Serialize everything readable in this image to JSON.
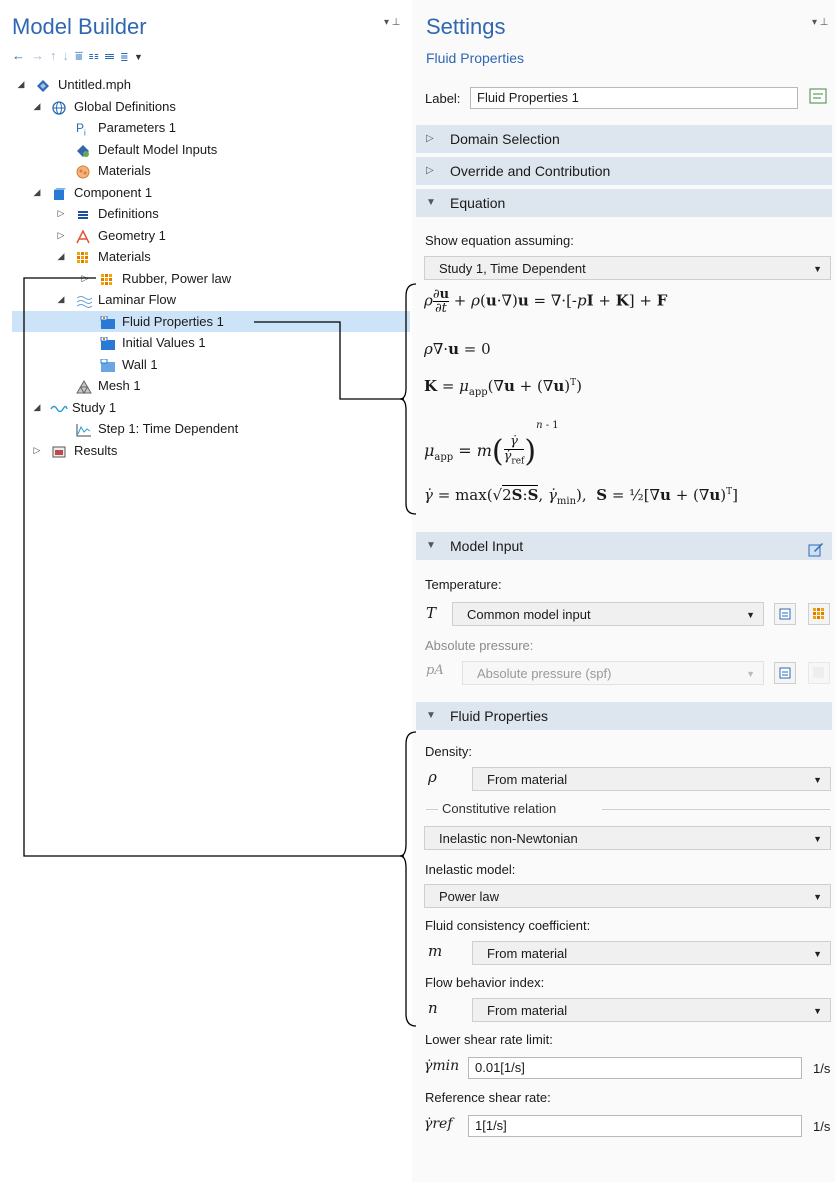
{
  "model_builder": {
    "title": "Model Builder",
    "toolbar_icons": [
      "back-icon",
      "forward-icon",
      "up-icon",
      "down-icon",
      "show-icon",
      "expand-icon",
      "collapse-icon",
      "list-icon",
      "dropdown-icon"
    ],
    "tree": [
      {
        "label": "Untitled.mph",
        "toggle": "◢",
        "icon": "model-icon"
      },
      {
        "label": "Global Definitions",
        "toggle": "◢",
        "icon": "globe-icon"
      },
      {
        "label": "Parameters 1",
        "icon": "parameters-icon",
        "prefix": "Pi"
      },
      {
        "label": "Default Model Inputs",
        "icon": "model-inputs-icon"
      },
      {
        "label": "Materials",
        "icon": "materials-icon"
      },
      {
        "label": "Component 1",
        "toggle": "◢",
        "icon": "component-icon"
      },
      {
        "label": "Definitions",
        "toggle": "▷",
        "icon": "definitions-icon"
      },
      {
        "label": "Geometry 1",
        "toggle": "▷",
        "icon": "geometry-icon"
      },
      {
        "label": "Materials",
        "toggle": "◢",
        "icon": "materials-icon"
      },
      {
        "label": "Rubber, Power law",
        "toggle": "▷",
        "icon": "material-icon"
      },
      {
        "label": "Laminar Flow",
        "toggle": "◢",
        "icon": "laminar-flow-icon"
      },
      {
        "label": "Fluid Properties 1",
        "icon": "fluid-properties-icon",
        "selected": true
      },
      {
        "label": "Initial Values 1",
        "icon": "initial-values-icon"
      },
      {
        "label": "Wall 1",
        "icon": "wall-icon"
      },
      {
        "label": "Mesh 1",
        "icon": "mesh-icon"
      },
      {
        "label": "Study 1",
        "toggle": "◢",
        "icon": "study-icon"
      },
      {
        "label": "Step 1: Time Dependent",
        "icon": "time-dependent-icon"
      },
      {
        "label": "Results",
        "toggle": "▷",
        "icon": "results-icon"
      }
    ]
  },
  "settings": {
    "title": "Settings",
    "subtitle": "Fluid Properties",
    "label_caption": "Label:",
    "label_value": "Fluid Properties 1",
    "sections": {
      "domain_selection": "Domain Selection",
      "override": "Override and Contribution",
      "equation": "Equation",
      "model_input": "Model Input",
      "fluid_properties": "Fluid Properties"
    },
    "equation": {
      "show_assuming_label": "Show equation assuming:",
      "show_assuming_value": "Study 1, Time Dependent"
    },
    "model_input": {
      "temperature_label": "Temperature:",
      "temperature_symbol": "T",
      "temperature_value": "Common model input",
      "pressure_label": "Absolute pressure:",
      "pressure_symbol": "pA",
      "pressure_value": "Absolute pressure (spf)"
    },
    "fluid": {
      "density_label": "Density:",
      "density_symbol": "ρ",
      "density_value": "From material",
      "constitutive_label": "Constitutive relation",
      "constitutive_value": "Inelastic non-Newtonian",
      "inelastic_label": "Inelastic model:",
      "inelastic_value": "Power law",
      "consistency_label": "Fluid consistency coefficient:",
      "consistency_symbol": "m",
      "consistency_value": "From material",
      "flow_index_label": "Flow behavior index:",
      "flow_index_symbol": "n",
      "flow_index_value": "From material",
      "lower_limit_label": "Lower shear rate limit:",
      "lower_limit_symbol": "γ̇min",
      "lower_limit_value": "0.01[1/s]",
      "lower_limit_unit": "1/s",
      "ref_rate_label": "Reference shear rate:",
      "ref_rate_symbol": "γ̇ref",
      "ref_rate_value": "1[1/s]",
      "ref_rate_unit": "1/s"
    }
  },
  "colors": {
    "accent": "#2f67b1",
    "section_bg": "#dde6ef",
    "selection": "#cde3f7"
  }
}
